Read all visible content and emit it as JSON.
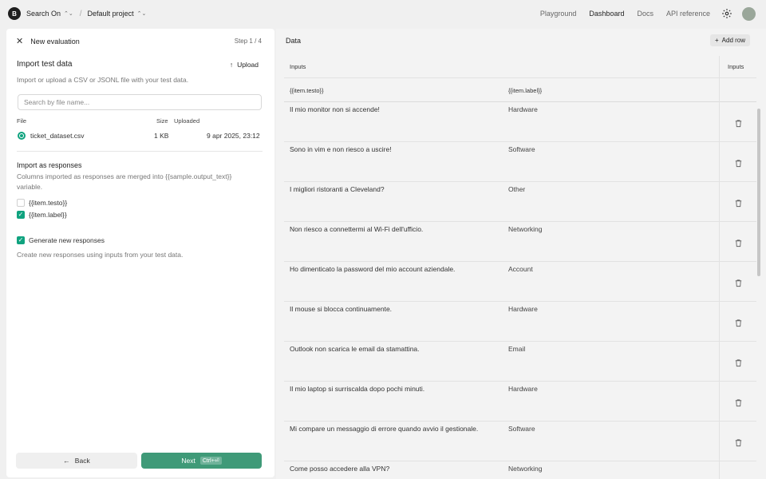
{
  "topbar": {
    "org_initial": "B",
    "org_name": "Search On",
    "project_name": "Default project",
    "nav": [
      "Playground",
      "Dashboard",
      "Docs",
      "API reference"
    ],
    "active_nav": "Dashboard"
  },
  "left": {
    "title": "New evaluation",
    "step": "Step 1 / 4",
    "import_title": "Import test data",
    "upload_label": "Upload",
    "import_desc": "Import or upload a CSV or JSONL file with your test data.",
    "search_placeholder": "Search by file name...",
    "columns": {
      "file": "File",
      "size": "Size",
      "uploaded": "Uploaded"
    },
    "file": {
      "name": "ticket_dataset.csv",
      "size": "1 KB",
      "uploaded": "9 apr 2025, 23:12",
      "selected": true
    },
    "responses_title": "Import as responses",
    "responses_desc_1": "Columns imported as responses are merged into {{sample.output_text}}",
    "responses_desc_2": "variable.",
    "checkboxes": [
      {
        "label": "{{item.testo}}",
        "checked": false
      },
      {
        "label": "{{item.label}}",
        "checked": true
      }
    ],
    "generate": {
      "label": "Generate new responses",
      "checked": true,
      "desc": "Create new responses using inputs from your test data."
    },
    "back_label": "Back",
    "next_label": "Next",
    "next_shortcut": "Ctrl+⏎"
  },
  "right": {
    "title": "Data",
    "add_row_label": "Add row",
    "group_header": "Inputs",
    "group_header_right": "Inputs",
    "col1": "{{item.testo}}",
    "col2": "{{item.label}}",
    "rows": [
      {
        "text": "Il mio monitor non si accende!",
        "label": "Hardware"
      },
      {
        "text": "Sono in vim e non riesco a uscire!",
        "label": "Software"
      },
      {
        "text": "I migliori ristoranti a Cleveland?",
        "label": "Other"
      },
      {
        "text": "Non riesco a connettermi al Wi-Fi dell'ufficio.",
        "label": "Networking"
      },
      {
        "text": "Ho dimenticato la password del mio account aziendale.",
        "label": "Account"
      },
      {
        "text": "Il mouse si blocca continuamente.",
        "label": "Hardware"
      },
      {
        "text": "Outlook non scarica le email da stamattina.",
        "label": "Email"
      },
      {
        "text": "Il mio laptop si surriscalda dopo pochi minuti.",
        "label": "Hardware"
      },
      {
        "text": "Mi compare un messaggio di errore quando avvio il gestionale.",
        "label": "Software"
      },
      {
        "text": "Come posso accedere alla VPN?",
        "label": "Networking"
      }
    ]
  }
}
